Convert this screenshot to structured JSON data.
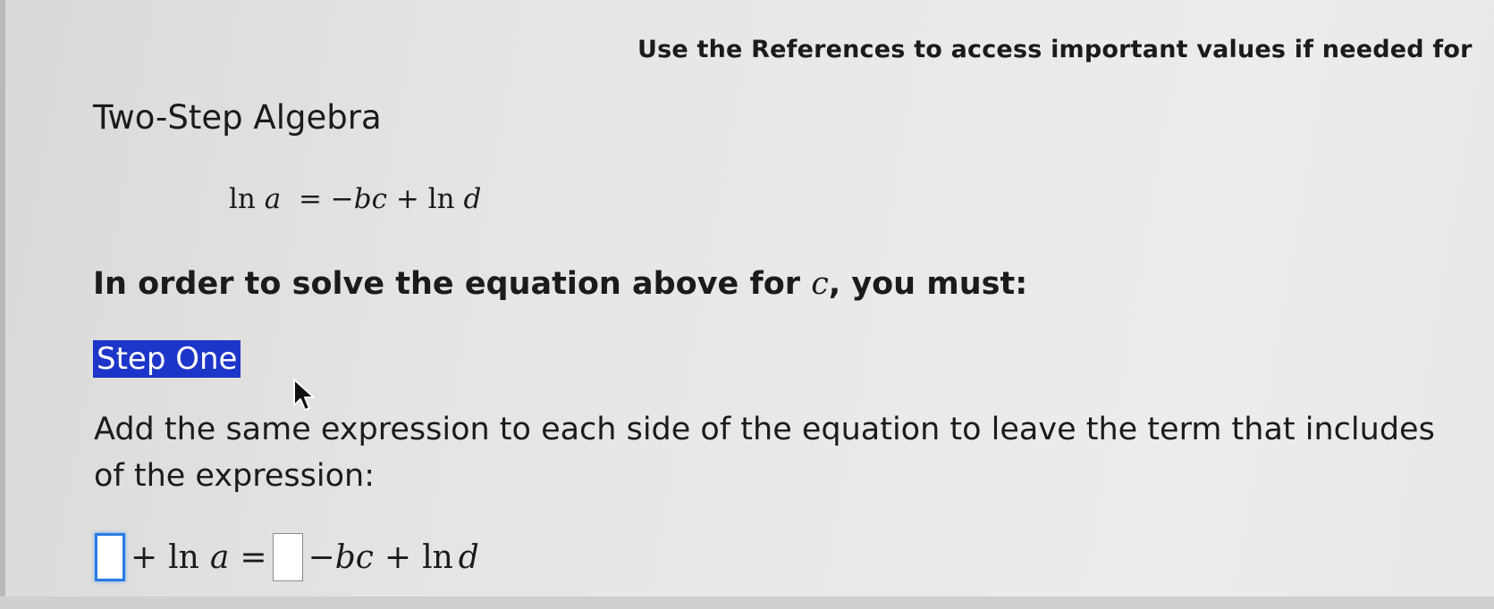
{
  "header": {
    "references_note": "Use the References to access important values if needed for"
  },
  "page": {
    "title": "Two-Step Algebra"
  },
  "problem": {
    "equation": {
      "ln1": "ln",
      "a": "a",
      "equals": "=",
      "minus": "−",
      "b": "b",
      "c": "c",
      "plus": "+",
      "ln2": "ln",
      "d": "d"
    },
    "question_prefix": "In order to solve the equation above for ",
    "question_var": "c",
    "question_suffix": ", you must:"
  },
  "step": {
    "label": "Step One",
    "instruction_line1": "Add the same expression to each side of the equation to leave the term that includes",
    "instruction_line2": "of the expression:"
  },
  "answer": {
    "box1_value": "",
    "box2_value": "",
    "plus1": "+",
    "ln1": "ln",
    "a": "a",
    "equals": "=",
    "minus": "−",
    "b": "b",
    "c": "c",
    "plus2": "+",
    "ln2": "ln",
    "d": "d"
  },
  "colors": {
    "highlight": "#1d36c9",
    "focus_border": "#2a7be4"
  },
  "icons": {
    "cursor": "mouse-pointer-icon"
  }
}
